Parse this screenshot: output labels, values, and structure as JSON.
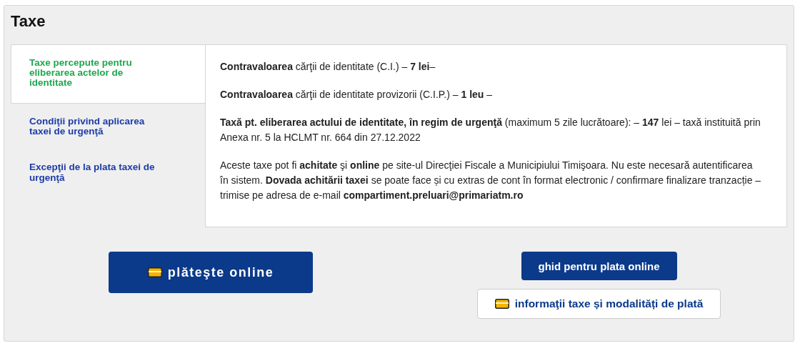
{
  "title": "Taxe",
  "tabs": [
    {
      "label": "Taxe percepute pentru eliberarea actelor de identitate",
      "selected": true
    },
    {
      "label": "Condiţii privind aplicarea taxei de urgenţă",
      "selected": false
    },
    {
      "label": "Excepţii de la plata taxei de urgenţă",
      "selected": false
    }
  ],
  "paragraphs": [
    "**Contravaloarea** cărţii de identitate (C.I.) – **7 lei**–",
    "**Contravaloarea** cărţii de identitate provizorii (C.I.P.) – **1 leu** –",
    "**Taxă pt. eliberarea actului de identitate, în regim de urgenţă** (maximum 5 zile lucrătoare): – **147** lei – taxă instituită prin Anexa nr. 5 la HCLMT nr.  664 din 27.12.2022",
    "Aceste taxe pot fi **achitate** şi **online** pe site-ul Direcţiei Fiscale a Municipiului Timişoara. Nu este necesară autentificarea în sistem. **Dovada achitării taxei** se poate face și cu extras de cont în format electronic / confirmare finalizare tranzacție – trimise pe adresa de e-mail **compartiment.preluari@primariatm.ro**"
  ],
  "buttons_left": [
    {
      "label": "plăteşte online",
      "kind": "large",
      "card_icon": true
    }
  ],
  "buttons_right": [
    {
      "label": "ghid pentru plata online",
      "kind": "primary",
      "card_icon": false
    },
    {
      "label": "informaţii taxe și modalități de plată",
      "kind": "outline",
      "card_icon": true
    }
  ]
}
